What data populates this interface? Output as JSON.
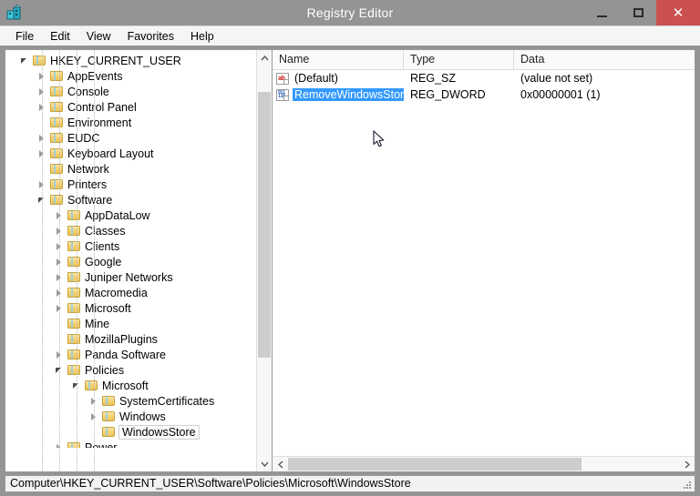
{
  "window": {
    "title": "Registry Editor",
    "icon": "regedit-icon",
    "buttons": {
      "minimize": "minimize-icon",
      "maximize": "maximize-icon",
      "close": "✕"
    },
    "close_color": "#cb5050",
    "titlebar_color": "#949494"
  },
  "menu": {
    "items": [
      "File",
      "Edit",
      "View",
      "Favorites",
      "Help"
    ]
  },
  "tree": {
    "nodes": [
      {
        "label": "HKEY_CURRENT_USER",
        "depth": 0,
        "state": "expanded"
      },
      {
        "label": "AppEvents",
        "depth": 1,
        "state": "collapsed"
      },
      {
        "label": "Console",
        "depth": 1,
        "state": "collapsed"
      },
      {
        "label": "Control Panel",
        "depth": 1,
        "state": "collapsed"
      },
      {
        "label": "Environment",
        "depth": 1,
        "state": "leaf"
      },
      {
        "label": "EUDC",
        "depth": 1,
        "state": "collapsed"
      },
      {
        "label": "Keyboard Layout",
        "depth": 1,
        "state": "collapsed"
      },
      {
        "label": "Network",
        "depth": 1,
        "state": "leaf"
      },
      {
        "label": "Printers",
        "depth": 1,
        "state": "collapsed"
      },
      {
        "label": "Software",
        "depth": 1,
        "state": "expanded"
      },
      {
        "label": "AppDataLow",
        "depth": 2,
        "state": "collapsed"
      },
      {
        "label": "Classes",
        "depth": 2,
        "state": "collapsed"
      },
      {
        "label": "Clients",
        "depth": 2,
        "state": "collapsed"
      },
      {
        "label": "Google",
        "depth": 2,
        "state": "collapsed"
      },
      {
        "label": "Juniper Networks",
        "depth": 2,
        "state": "collapsed"
      },
      {
        "label": "Macromedia",
        "depth": 2,
        "state": "collapsed"
      },
      {
        "label": "Microsoft",
        "depth": 2,
        "state": "collapsed"
      },
      {
        "label": "Mine",
        "depth": 2,
        "state": "leaf"
      },
      {
        "label": "MozillaPlugins",
        "depth": 2,
        "state": "leaf"
      },
      {
        "label": "Panda Software",
        "depth": 2,
        "state": "collapsed"
      },
      {
        "label": "Policies",
        "depth": 2,
        "state": "expanded"
      },
      {
        "label": "Microsoft",
        "depth": 3,
        "state": "expanded"
      },
      {
        "label": "SystemCertificates",
        "depth": 4,
        "state": "collapsed"
      },
      {
        "label": "Windows",
        "depth": 4,
        "state": "collapsed"
      },
      {
        "label": "WindowsStore",
        "depth": 4,
        "state": "leaf",
        "selected": true
      }
    ],
    "clipped_node": {
      "label": "Power",
      "depth": 2,
      "state": "collapsed"
    }
  },
  "list": {
    "columns": [
      "Name",
      "Type",
      "Data"
    ],
    "rows": [
      {
        "icon": "string-value-icon",
        "name": "(Default)",
        "type": "REG_SZ",
        "data": "(value not set)",
        "selected": false
      },
      {
        "icon": "dword-value-icon",
        "name": "RemoveWindowsStore",
        "type": "REG_DWORD",
        "data": "0x00000001 (1)",
        "selected": true
      }
    ],
    "selection_color": "#3399ff"
  },
  "scrollbars": {
    "tree_vertical": {
      "up": "▲",
      "down": "▼",
      "thumb_top_pct": 7,
      "thumb_height_pct": 71
    },
    "list_horizontal": {
      "left": "❮",
      "right": "❯",
      "thumb_left_pct": 0,
      "thumb_width_pct": 76
    }
  },
  "statusbar": {
    "path": "Computer\\HKEY_CURRENT_USER\\Software\\Policies\\Microsoft\\WindowsStore"
  }
}
